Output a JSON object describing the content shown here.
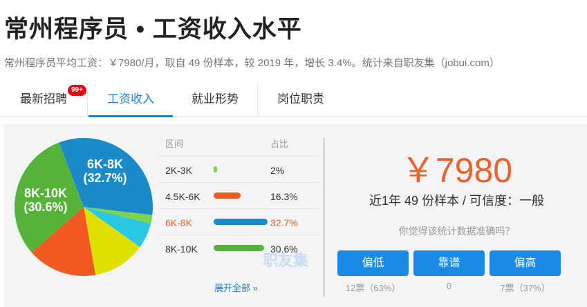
{
  "header": {
    "title": "常州程序员 • 工资收入水平",
    "subtitle": "常州程序员平均工资：￥7980/月，取自 49 份样本，较 2019 年，增长 3.4%。统计来自职友集（jobui.com）"
  },
  "tabs": [
    {
      "label": "最新招聘",
      "badge": "99+"
    },
    {
      "label": "工资收入",
      "active": true
    },
    {
      "label": "就业形势"
    },
    {
      "label": "岗位职责"
    }
  ],
  "table": {
    "header_range": "区间",
    "header_pct": "占比",
    "rows": [
      {
        "range": "2K-3K",
        "pct": "2%",
        "value": 2.0,
        "color": "#7ed348"
      },
      {
        "range": "4.5K-6K",
        "pct": "16.3%",
        "value": 16.3,
        "color": "#f05a22"
      },
      {
        "range": "6K-8K",
        "pct": "32.7%",
        "value": 32.7,
        "color": "#1b8ac9",
        "highlight": true
      },
      {
        "range": "8K-10K",
        "pct": "30.6%",
        "value": 30.6,
        "color": "#56b33a"
      }
    ],
    "expand_link": "展开全部 »"
  },
  "chart_data": {
    "type": "pie",
    "slices": [
      {
        "label": "6K-8K",
        "value": 32.7,
        "color": "#1b8ac9",
        "text": "6K-8K",
        "pct_text": "(32.7%)"
      },
      {
        "label": "2K-3K",
        "value": 2.0,
        "color": "#7ed348"
      },
      {
        "label": "unlabeled-cyan",
        "value": 6.0,
        "color": "#2bc8e6"
      },
      {
        "label": "unlabeled-yellow",
        "value": 12.4,
        "color": "#dfe000"
      },
      {
        "label": "4.5K-6K",
        "value": 16.3,
        "color": "#f05a22"
      },
      {
        "label": "8K-10K",
        "value": 30.6,
        "color": "#56b33a",
        "text": "8K-10K",
        "pct_text": "(30.6%)"
      }
    ]
  },
  "summary": {
    "amount": "￥7980",
    "samples": "近1年 49 份样本 / 可信度：一般",
    "question": "你觉得该统计数据准确吗？",
    "watermark": "职友集"
  },
  "votes": [
    {
      "label": "偏低",
      "count": "12票（63%）"
    },
    {
      "label": "靠谱",
      "count": "0"
    },
    {
      "label": "偏高",
      "count": "7票（37%）"
    }
  ]
}
